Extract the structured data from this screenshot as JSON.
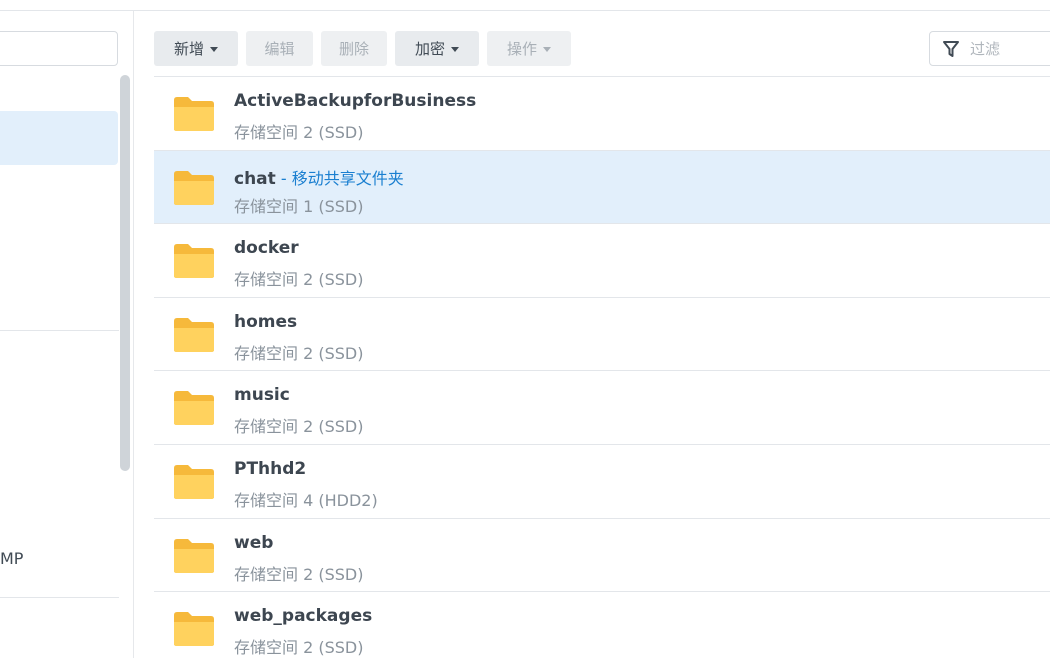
{
  "toolbar": {
    "buttons": [
      {
        "label": "新增",
        "enabled": true,
        "dropdown": true
      },
      {
        "label": "编辑",
        "enabled": false,
        "dropdown": false
      },
      {
        "label": "删除",
        "enabled": false,
        "dropdown": false
      },
      {
        "label": "加密",
        "enabled": true,
        "dropdown": true
      },
      {
        "label": "操作",
        "enabled": false,
        "dropdown": true
      }
    ],
    "filter_placeholder": "过滤"
  },
  "sidebar": {
    "partial_label": "MP"
  },
  "folders": [
    {
      "name": "ActiveBackupforBusiness",
      "note": "",
      "location": "存储空间 2 (SSD)",
      "selected": false
    },
    {
      "name": "chat",
      "note": " - 移动共享文件夹",
      "location": "存储空间 1 (SSD)",
      "selected": true
    },
    {
      "name": "docker",
      "note": "",
      "location": "存储空间 2 (SSD)",
      "selected": false
    },
    {
      "name": "homes",
      "note": "",
      "location": "存储空间 2 (SSD)",
      "selected": false
    },
    {
      "name": "music",
      "note": "",
      "location": "存储空间 2 (SSD)",
      "selected": false
    },
    {
      "name": "PThhd2",
      "note": "",
      "location": "存储空间 4 (HDD2)",
      "selected": false
    },
    {
      "name": "web",
      "note": "",
      "location": "存储空间 2 (SSD)",
      "selected": false
    },
    {
      "name": "web_packages",
      "note": "",
      "location": "存储空间 2 (SSD)",
      "selected": false
    }
  ],
  "colors": {
    "accent": "#1a7fd0",
    "selected_row": "#e2effb",
    "folder_back": "#f6b93b",
    "folder_front": "#ffd25e"
  }
}
